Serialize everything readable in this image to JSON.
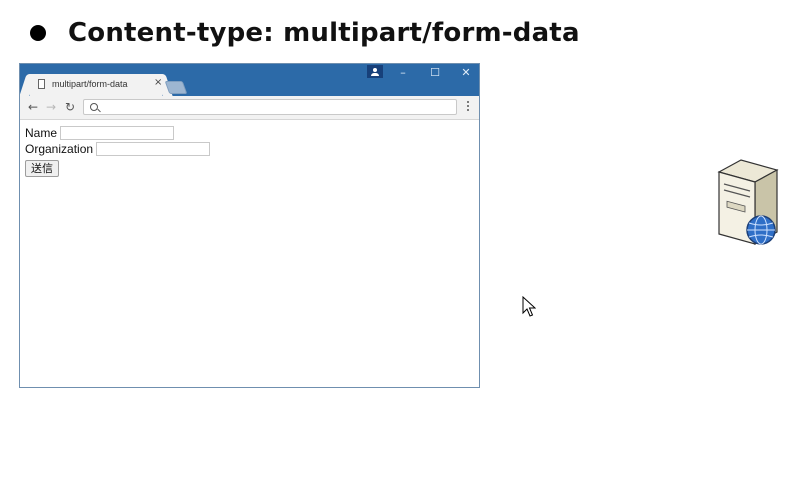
{
  "slide": {
    "heading": "Content-type: multipart/form-data"
  },
  "browser": {
    "tab_title": "multipart/form-data",
    "tab_close": "×",
    "address_value": "",
    "window_controls": {
      "minimize": "–",
      "maximize": "☐",
      "close": "✕"
    },
    "nav": {
      "back": "←",
      "forward": "→",
      "reload": "↻"
    }
  },
  "form": {
    "name_label": "Name",
    "name_value": "",
    "organization_label": "Organization",
    "organization_value": "",
    "submit_label": "送信"
  },
  "colors": {
    "titlebar": "#2c6aa8",
    "tab": "#f2f2f2",
    "window_border": "#6f8faf"
  }
}
